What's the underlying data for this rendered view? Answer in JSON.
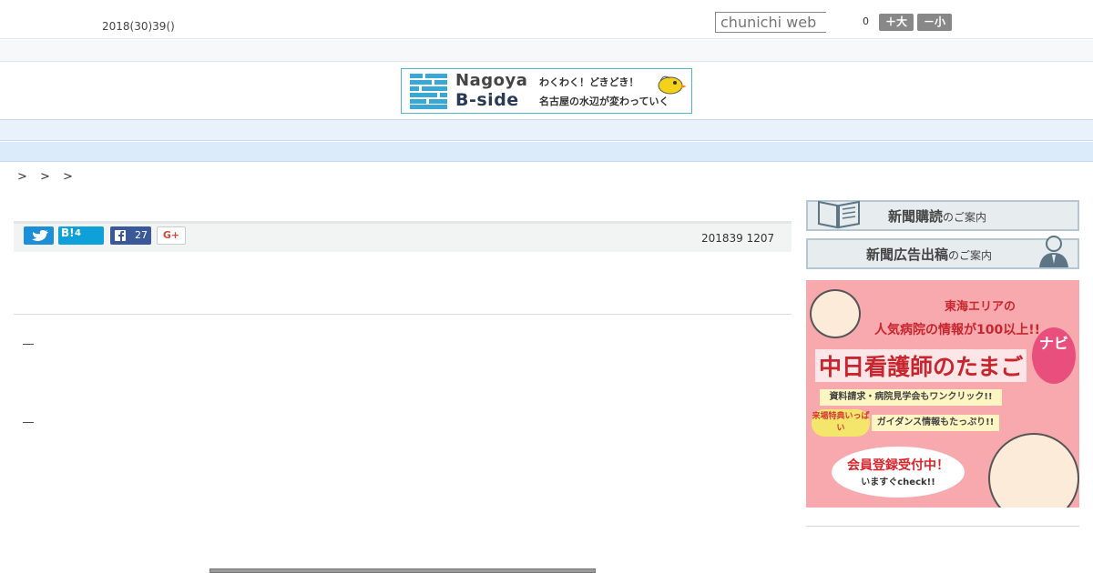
{
  "header": {
    "date": "2018(30)39()",
    "search_placeholder": "chunichi web",
    "font_size_value": "0",
    "font_bigger_label": "＋大",
    "font_smaller_label": "－小"
  },
  "logo": {
    "line1_en": "Nagoya",
    "line2_en": "B-side",
    "tagline1": "わくわく！どきどき！",
    "tagline2": "名古屋の水辺が変わっていく"
  },
  "nav": {
    "items": [
      "",
      "",
      "",
      "",
      "",
      "",
      "",
      "",
      ""
    ]
  },
  "breadcrumb": "> > >",
  "share": {
    "hatena_label": "B!",
    "hatena_count": "4",
    "facebook_count": "27",
    "gplus_label": "G+"
  },
  "article": {
    "published": "201839 1207",
    "dash1": "―",
    "dash2": "―"
  },
  "sidebar": {
    "subscribe_main": "新聞購読",
    "subscribe_sub": "のご案内",
    "ads_main": "新聞広告出稿",
    "ads_sub": "のご案内",
    "ad": {
      "line1": "東海エリアの",
      "line2": "人気病院の情報が100以上!!",
      "title": "中日看護師のたまご",
      "navi": "ナビ",
      "strip1": "資料請求・病院見学会もワンクリック!!",
      "pill": "来場特典いっぱい",
      "strip2": "ガイダンス情報もたっぷり!!",
      "bubble1": "会員登録受付中！",
      "bubble2": "いますぐcheck!!"
    }
  },
  "colors": {
    "nav_bg": "#e9f1fa",
    "twitter": "#1d8fd6",
    "hatena": "#0ea0d8",
    "facebook": "#3b5999",
    "ad_bg": "#f7a9ae"
  }
}
